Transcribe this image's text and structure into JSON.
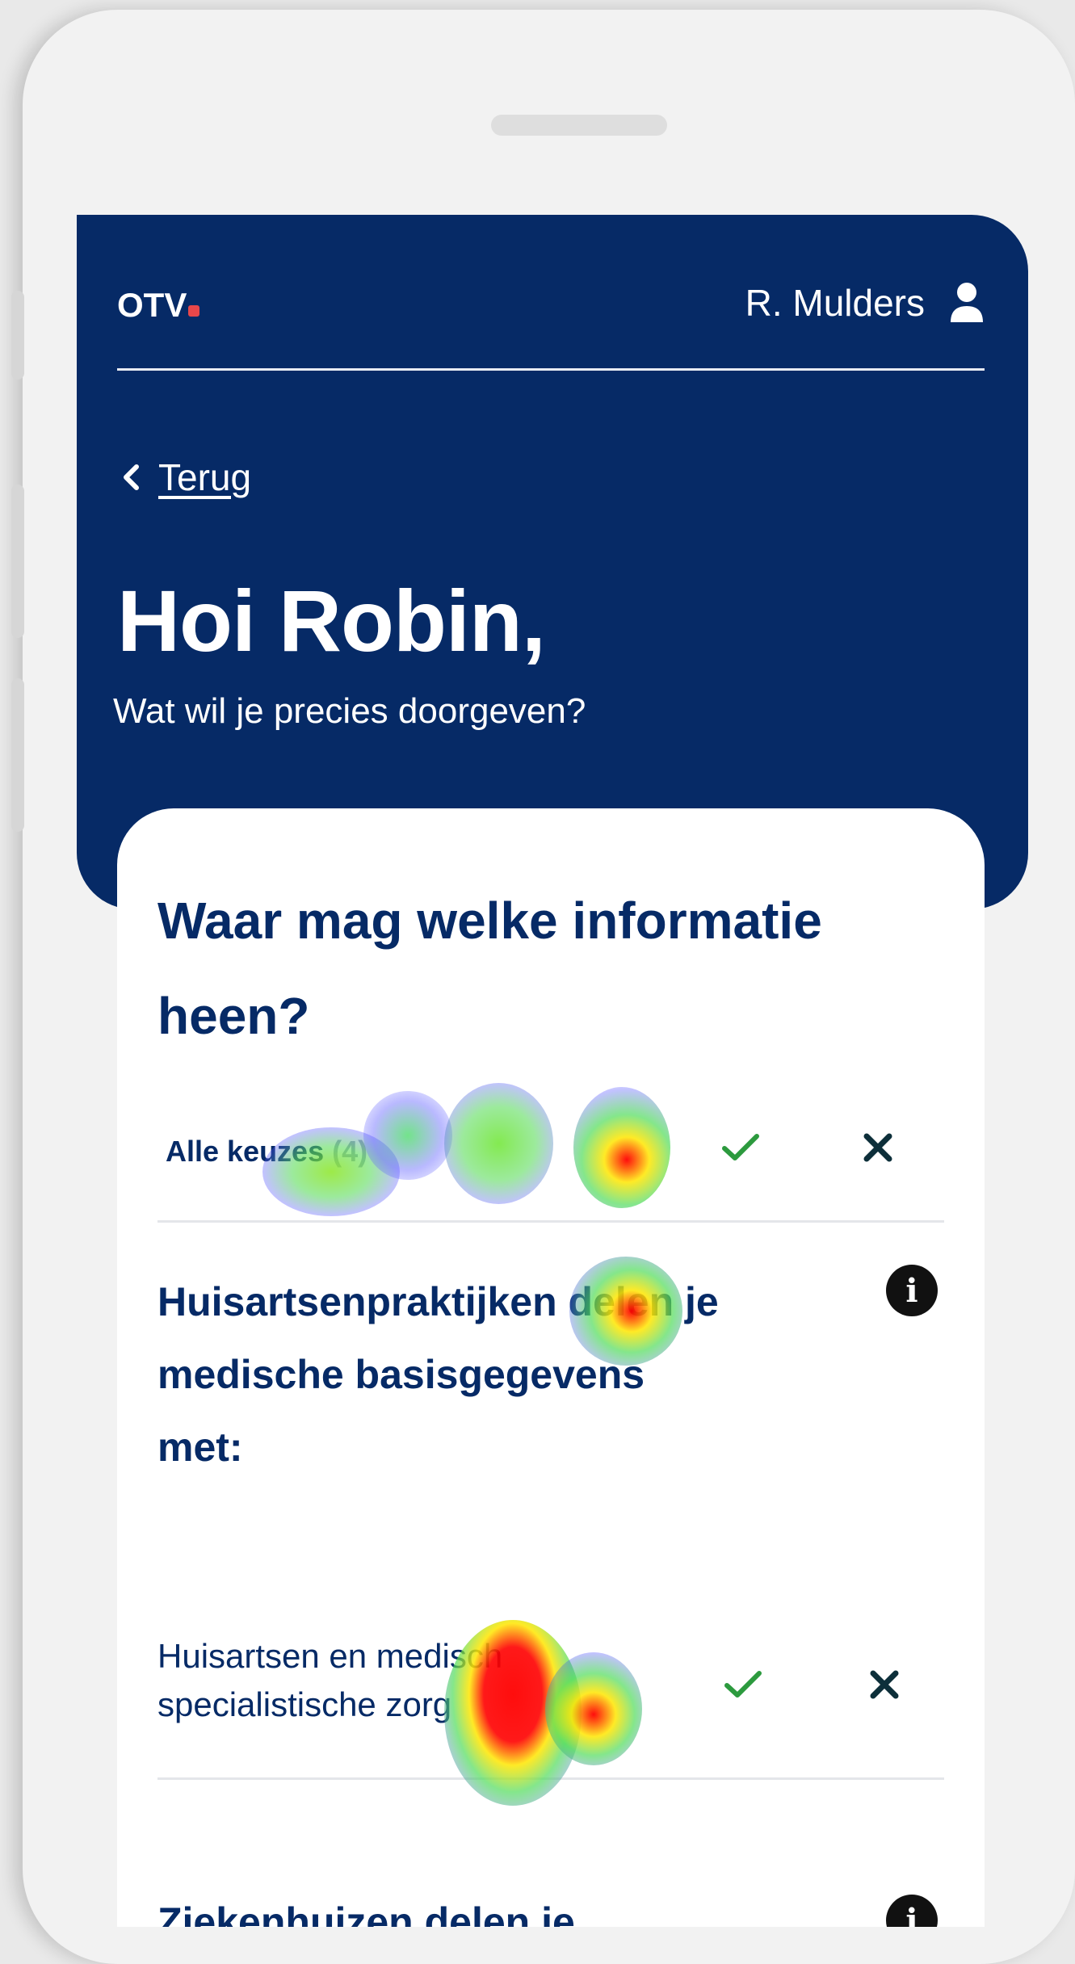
{
  "header": {
    "logo": "OTV",
    "user_name": "R. Mulders",
    "back_label": "Terug",
    "greeting": "Hoi Robin,",
    "subtitle": "Wat wil je precies doorgeven?"
  },
  "card": {
    "title": "Waar mag welke informatie heen?",
    "all_choices": {
      "label": "Alle keuzes",
      "count": "(4)"
    },
    "section": {
      "title": "Huisartsenpraktijken delen je medische basisgegevens met:",
      "item_label": "Huisartsen en medisch specialistische zorg"
    },
    "next_section_title": "Ziekenhuizen delen je"
  },
  "icons": {
    "user": "user-icon",
    "back": "chevron-left-icon",
    "check": "check-icon",
    "close": "close-icon",
    "info": "info-icon"
  },
  "colors": {
    "header_bg": "#062a66",
    "brand_dot": "#e8474a",
    "text_primary": "#062a66",
    "check": "#2c9a3e"
  }
}
